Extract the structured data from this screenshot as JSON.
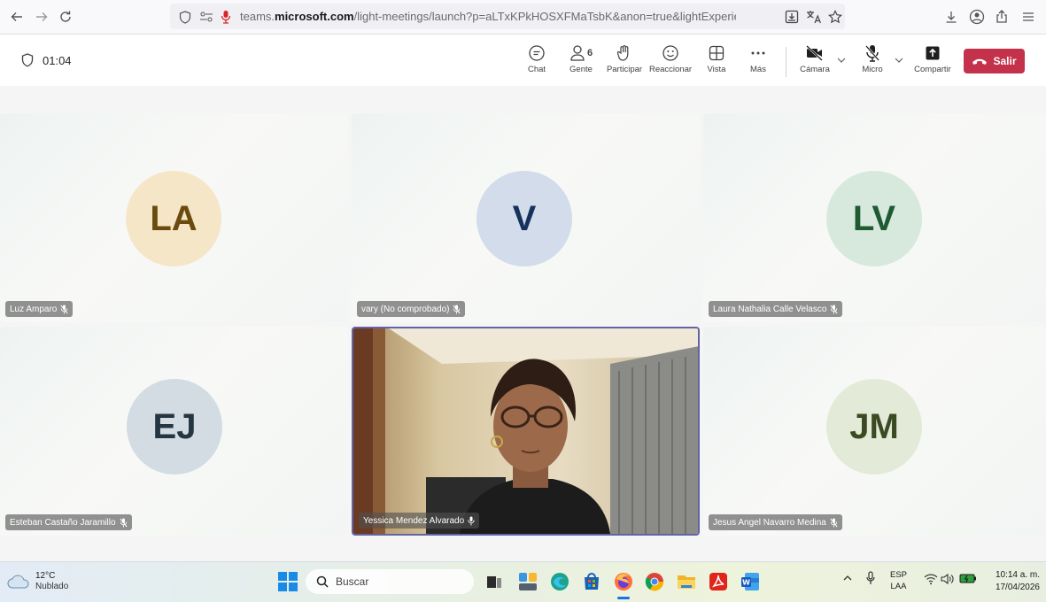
{
  "browser": {
    "url_prefix": "teams.",
    "url_domain": "microsoft.com",
    "url_path": "/light-meetings/launch?p=aLTxKPkHOSXFMaTsbK&anon=true&lightExperience=true&correlat"
  },
  "meeting": {
    "timer": "01:04",
    "toolbar": {
      "chat": "Chat",
      "people": "Gente",
      "people_count": "6",
      "raise": "Participar",
      "react": "Reaccionar",
      "view": "Vista",
      "more": "Más",
      "camera": "Cámara",
      "mic": "Micro",
      "share": "Compartir",
      "leave": "Salir"
    },
    "participants": [
      {
        "initials": "LA",
        "name": "Luz Amparo",
        "avatar_bg": "#f6e6c8",
        "avatar_fg": "#6b4a0f",
        "muted": true
      },
      {
        "initials": "V",
        "name": "vary (No comprobado)",
        "avatar_bg": "#d2dcea",
        "avatar_fg": "#16325c",
        "muted": true
      },
      {
        "initials": "LV",
        "name": "Laura Nathalia Calle Velasco",
        "avatar_bg": "#d7e9dd",
        "avatar_fg": "#1f5a32",
        "muted": true
      },
      {
        "initials": "EJ",
        "name": "Esteban Castaño Jaramillo",
        "avatar_bg": "#d3dce2",
        "avatar_fg": "#253642",
        "muted": true
      },
      {
        "initials": "",
        "name": "Yessica Mendez Alvarado",
        "video": true,
        "muted": false
      },
      {
        "initials": "JM",
        "name": "Jesus Angel Navarro Medina",
        "avatar_bg": "#e4ead8",
        "avatar_fg": "#3a4a22",
        "muted": true
      }
    ]
  },
  "taskbar": {
    "weather_temp": "12°C",
    "weather_desc": "Nublado",
    "search_placeholder": "Buscar",
    "lang_top": "ESP",
    "lang_bottom": "LAA",
    "time": "10:14 a. m.",
    "date": "17/04/2026"
  },
  "colors": {
    "accent": "#6264a7",
    "leave": "#c4314b"
  }
}
